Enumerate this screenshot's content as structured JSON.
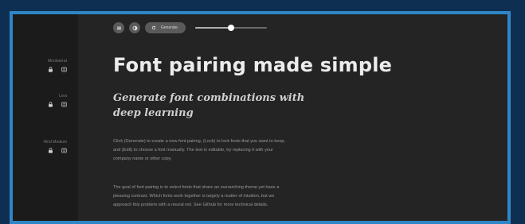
{
  "sidebar": {
    "groups": [
      {
        "label": "Montserrat",
        "icons": [
          "lock-icon",
          "edit-icon"
        ]
      },
      {
        "label": "Lora",
        "icons": [
          "lock-icon",
          "edit-icon"
        ]
      },
      {
        "label": "Hind Medium",
        "icons": [
          "lock-icon",
          "edit-icon"
        ]
      }
    ]
  },
  "toolbar": {
    "icons": [
      "menu-icon",
      "contrast-icon",
      "refresh-icon"
    ],
    "generate_label": "Generate",
    "slider_value": 0.5
  },
  "main": {
    "title": "Font pairing made simple",
    "subtitle": "Generate font combinations with deep learning",
    "paragraph1": "Click (Generate) to create a new font pairing, (Lock) to lock fonts that you want to keep, and (Edit) to choose a font manually. The text is editable, try replacing it with your company name or other copy.",
    "paragraph2": "The goal of font pairing is to select fonts that share an overarching theme yet have a pleasing contrast. Which fonts work together is largely a matter of intuition, but we approach this problem with a neural net. See Github for more technical details."
  }
}
